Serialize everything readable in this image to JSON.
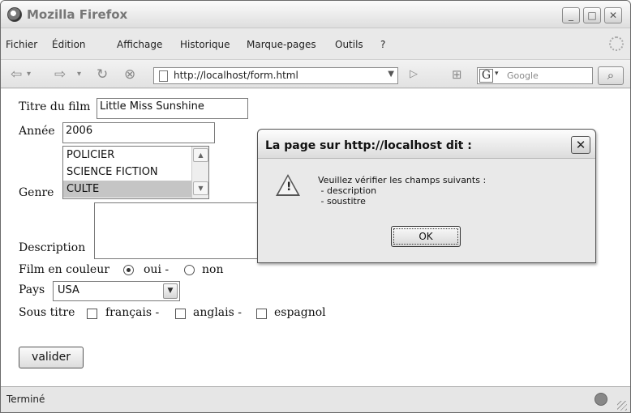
{
  "window": {
    "title": "Mozilla Firefox",
    "minimize": "_",
    "maximize": "□",
    "close": "✕"
  },
  "menu": [
    "Fichier",
    "Édition",
    "Affichage",
    "Historique",
    "Marque-pages",
    "Outils",
    "?"
  ],
  "nav": {
    "url": "http://localhost/form.html",
    "search_placeholder": "Google"
  },
  "form": {
    "titre_label": "Titre du film",
    "titre_value": "Little Miss Sunshine",
    "annee_label": "Année",
    "annee_value": "2006",
    "genre_label": "Genre",
    "genre_options": [
      "POLICIER",
      "SCIENCE FICTION",
      "CULTE"
    ],
    "genre_selected": "CULTE",
    "description_label": "Description",
    "couleur_label": "Film en couleur",
    "couleur_oui": "oui -",
    "couleur_non": "non",
    "couleur_selected": "oui",
    "pays_label": "Pays",
    "pays_value": "USA",
    "soustitre_label": "Sous titre",
    "soustitre_options": [
      "français -",
      "anglais -",
      "espagnol"
    ],
    "submit_label": "valider"
  },
  "status": {
    "text": "Terminé"
  },
  "dialog": {
    "title": "La page sur http://localhost dit :",
    "message_lines": [
      "Veuillez vérifier les champs suivants :",
      " - description",
      " - soustitre"
    ],
    "ok_label": "OK",
    "icon": "warning-icon"
  }
}
